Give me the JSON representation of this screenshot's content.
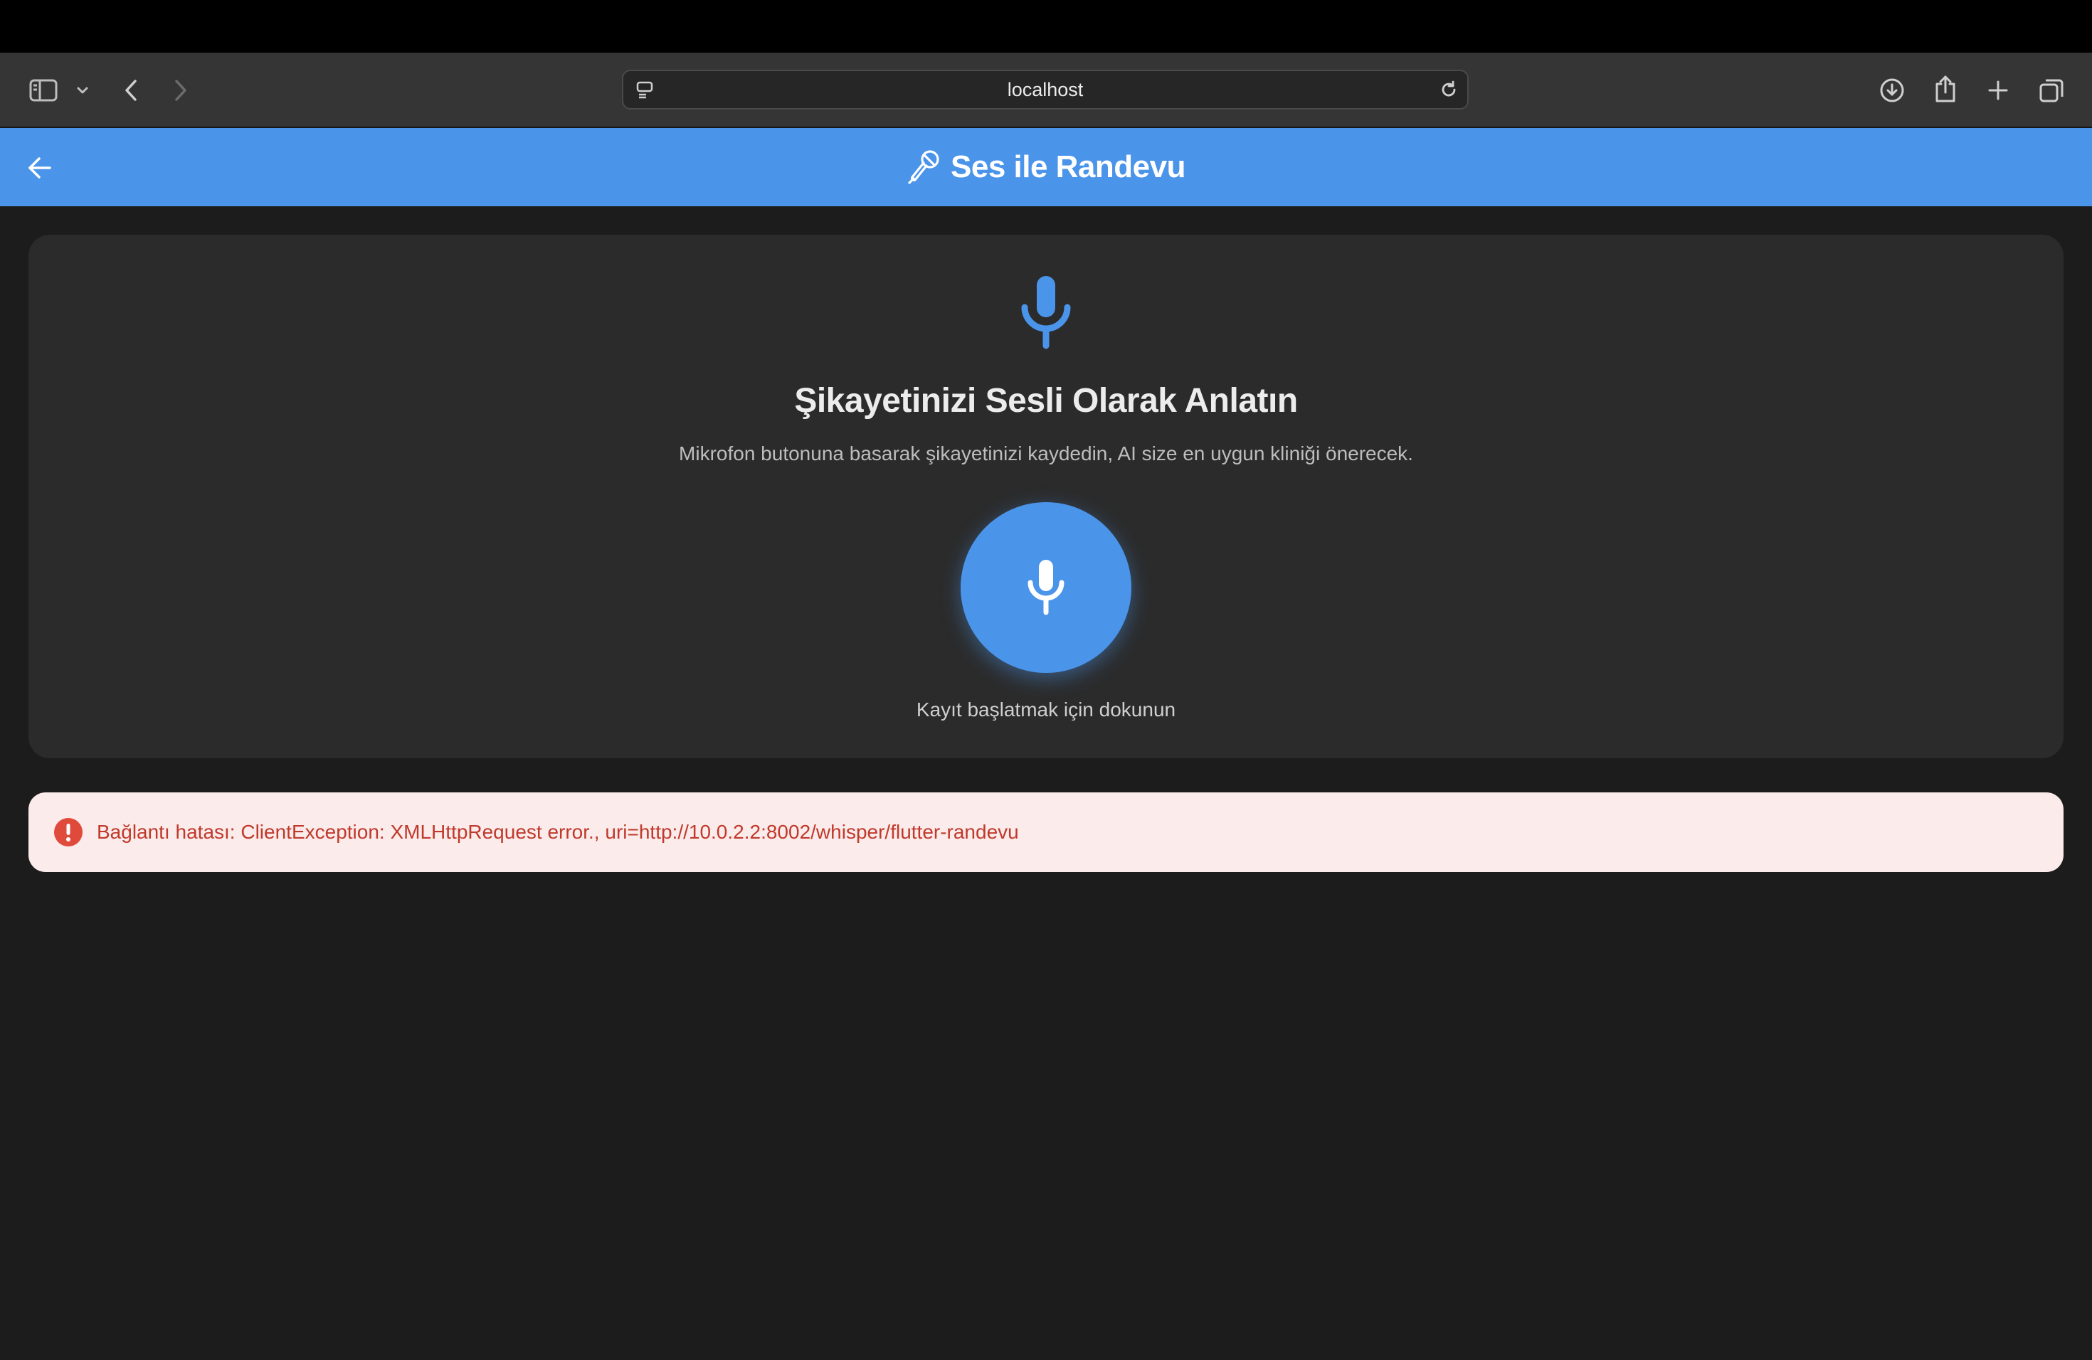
{
  "browser": {
    "address": "localhost"
  },
  "app_bar": {
    "title": "Ses ile Randevu"
  },
  "card": {
    "title": "Şikayetinizi Sesli Olarak Anlatın",
    "subtitle": "Mikrofon butonuna basarak şikayetinizi kaydedin, AI size en uygun kliniği önerecek.",
    "record_hint": "Kayıt başlatmak için dokunun"
  },
  "error": {
    "message": "Bağlantı hatası: ClientException: XMLHttpRequest error., uri=http://10.0.2.2:8002/whisper/flutter-randevu"
  },
  "colors": {
    "accent": "#4a94ea",
    "error_bg": "#fcebeb",
    "error_text": "#c0392b",
    "background": "#1c1c1c",
    "card": "#2b2b2b"
  },
  "icons": {
    "toolbar": [
      "sidebar-icon",
      "chevron-down-icon",
      "back-icon",
      "forward-icon",
      "site-settings-icon",
      "reload-icon",
      "download-icon",
      "share-icon",
      "plus-icon",
      "tabs-icon"
    ],
    "app_bar": [
      "arrow-back-icon",
      "microphone-icon"
    ],
    "card": [
      "microphone-icon"
    ],
    "error": [
      "error-icon"
    ]
  }
}
